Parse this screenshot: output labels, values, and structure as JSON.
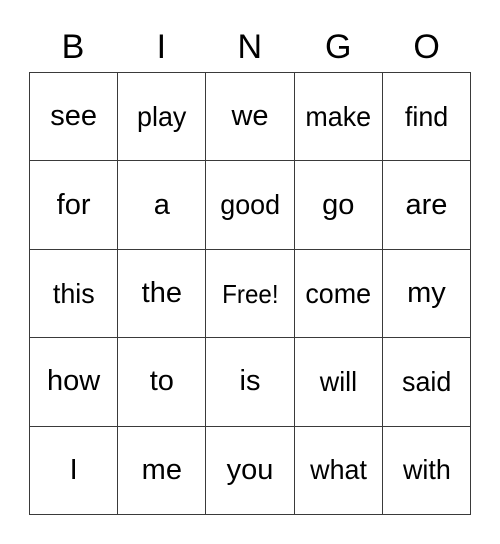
{
  "card": {
    "title": "BINGO",
    "header_letters": [
      "B",
      "I",
      "N",
      "G",
      "O"
    ],
    "free_space_label": "Free!",
    "free_space_position": {
      "row": 2,
      "column": 2
    },
    "grid_size": "5x5",
    "colors": {
      "background": "#ffffff",
      "text": "#000000",
      "grid_line": "#3a3a3a"
    },
    "rows": [
      {
        "cells": [
          {
            "text": "see"
          },
          {
            "text": "play"
          },
          {
            "text": "we"
          },
          {
            "text": "make"
          },
          {
            "text": "find"
          }
        ]
      },
      {
        "cells": [
          {
            "text": "for"
          },
          {
            "text": "a"
          },
          {
            "text": "good"
          },
          {
            "text": "go"
          },
          {
            "text": "are"
          }
        ]
      },
      {
        "cells": [
          {
            "text": "this"
          },
          {
            "text": "the"
          },
          {
            "text": "Free!"
          },
          {
            "text": "come"
          },
          {
            "text": "my"
          }
        ]
      },
      {
        "cells": [
          {
            "text": "how"
          },
          {
            "text": "to"
          },
          {
            "text": "is"
          },
          {
            "text": "will"
          },
          {
            "text": "said"
          }
        ]
      },
      {
        "cells": [
          {
            "text": "I"
          },
          {
            "text": "me"
          },
          {
            "text": "you"
          },
          {
            "text": "what"
          },
          {
            "text": "with"
          }
        ]
      }
    ]
  }
}
